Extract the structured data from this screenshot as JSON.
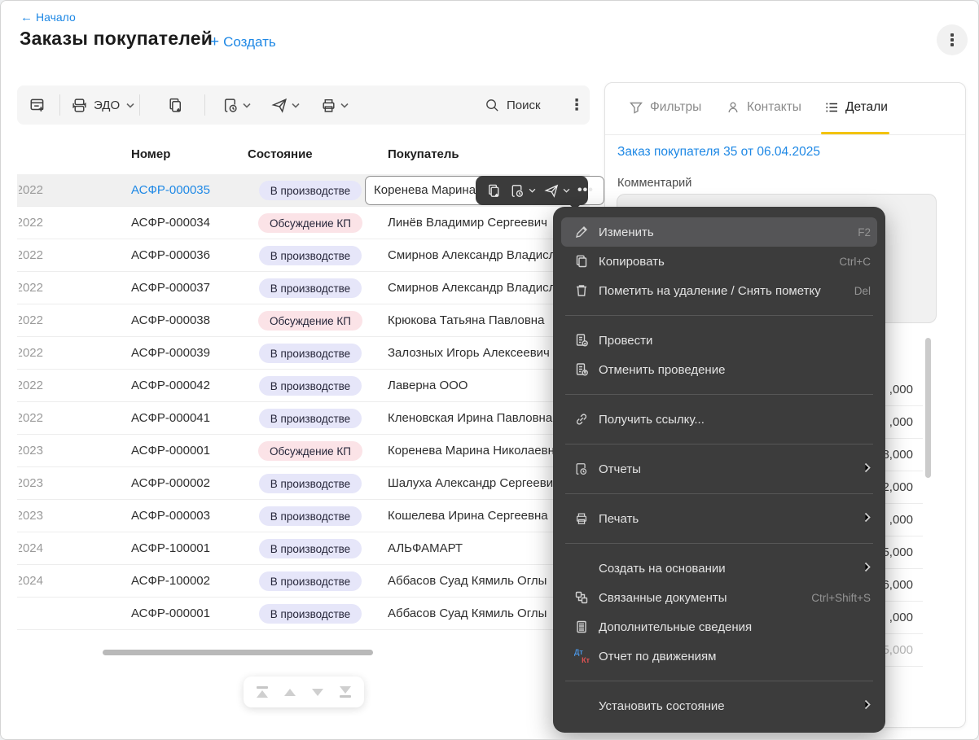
{
  "header": {
    "back_label": "Начало",
    "back_arrow": "←",
    "title": "Заказы покупателей",
    "create_plus": "+",
    "create_label": "Создать"
  },
  "toolbar": {
    "edo_label": "ЭДО",
    "search_label": "Поиск",
    "icons": [
      "new-document-icon",
      "edo-documents-icon",
      "copy-icon",
      "report-icon",
      "send-icon",
      "print-icon",
      "search-icon",
      "more-vertical-icon"
    ]
  },
  "table": {
    "columns": {
      "number": "Номер",
      "status": "Состояние",
      "buyer": "Покупатель"
    },
    "status_colors": {
      "В производстве": "#e6e6f9",
      "Обсуждение КП": "#fbe3e7"
    },
    "rows": [
      {
        "date": "2022",
        "number": "АСФР-000035",
        "status": "В производстве",
        "buyer": "Коренева Марина Николаевна",
        "selected": true
      },
      {
        "date": "2022",
        "number": "АСФР-000034",
        "status": "Обсуждение КП",
        "buyer": "Линёв Владимир Сергеевич"
      },
      {
        "date": "2022",
        "number": "АСФР-000036",
        "status": "В производстве",
        "buyer": "Смирнов Александр Владислав"
      },
      {
        "date": "2022",
        "number": "АСФР-000037",
        "status": "В производстве",
        "buyer": "Смирнов Александр Владислав"
      },
      {
        "date": "2022",
        "number": "АСФР-000038",
        "status": "Обсуждение КП",
        "buyer": "Крюкова Татьяна Павловна"
      },
      {
        "date": "2022",
        "number": "АСФР-000039",
        "status": "В производстве",
        "buyer": "Залозных Игорь Алексеевич"
      },
      {
        "date": "2022",
        "number": "АСФР-000042",
        "status": "В производстве",
        "buyer": "Лаверна ООО"
      },
      {
        "date": "2022",
        "number": "АСФР-000041",
        "status": "В производстве",
        "buyer": "Кленовская Ирина Павловна"
      },
      {
        "date": "2023",
        "number": "АСФР-000001",
        "status": "Обсуждение КП",
        "buyer": "Коренева Марина Николаевна"
      },
      {
        "date": "2023",
        "number": "АСФР-000002",
        "status": "В производстве",
        "buyer": "Шалуха Александр Сергеевич"
      },
      {
        "date": "2023",
        "number": "АСФР-000003",
        "status": "В производстве",
        "buyer": "Кошелева Ирина Сергеевна"
      },
      {
        "date": "2024",
        "number": "АСФР-100001",
        "status": "В производстве",
        "buyer": "АЛЬФАМАРТ"
      },
      {
        "date": "2024",
        "number": "АСФР-100002",
        "status": "В производстве",
        "buyer": "Аббасов Суад Кямиль Оглы"
      },
      {
        "date": "",
        "number": "АСФР-000001",
        "status": "В производстве",
        "buyer": "Аббасов Суад Кямиль Оглы"
      }
    ]
  },
  "row_toolbar": {
    "icons": [
      "copy-icon",
      "report-icon",
      "send-icon",
      "ellipsis-icon"
    ]
  },
  "panel": {
    "tabs": {
      "filters": "Фильтры",
      "contacts": "Контакты",
      "details": "Детали"
    },
    "active_tab": "Детали",
    "tab_underline_color": "#f3c300",
    "doc_link": "Заказ покупателя 35 от 06.04.2025",
    "comment_label": "Комментарий",
    "sums": [
      ",000",
      ",000",
      "8,000",
      "2,000",
      ",000",
      "5,000",
      "6,000",
      ",000",
      "5,000"
    ]
  },
  "context_menu": {
    "background": "#3c3c3c",
    "items": [
      {
        "label": "Изменить",
        "shortcut": "F2"
      },
      {
        "label": "Копировать",
        "shortcut": "Ctrl+C"
      },
      {
        "label": "Пометить на удаление / Снять пометку",
        "shortcut": "Del"
      },
      {
        "label": "Провести"
      },
      {
        "label": "Отменить проведение"
      },
      {
        "label": "Получить ссылку..."
      },
      {
        "label": "Отчеты"
      },
      {
        "label": "Печать"
      },
      {
        "label": "Создать на основании"
      },
      {
        "label": "Связанные документы",
        "shortcut": "Ctrl+Shift+S"
      },
      {
        "label": "Дополнительные сведения"
      },
      {
        "label": "Отчет по движениям"
      },
      {
        "label": "Установить состояние"
      }
    ],
    "dtkt_icon": {
      "dt": "Дт",
      "kt": "Кт"
    }
  }
}
